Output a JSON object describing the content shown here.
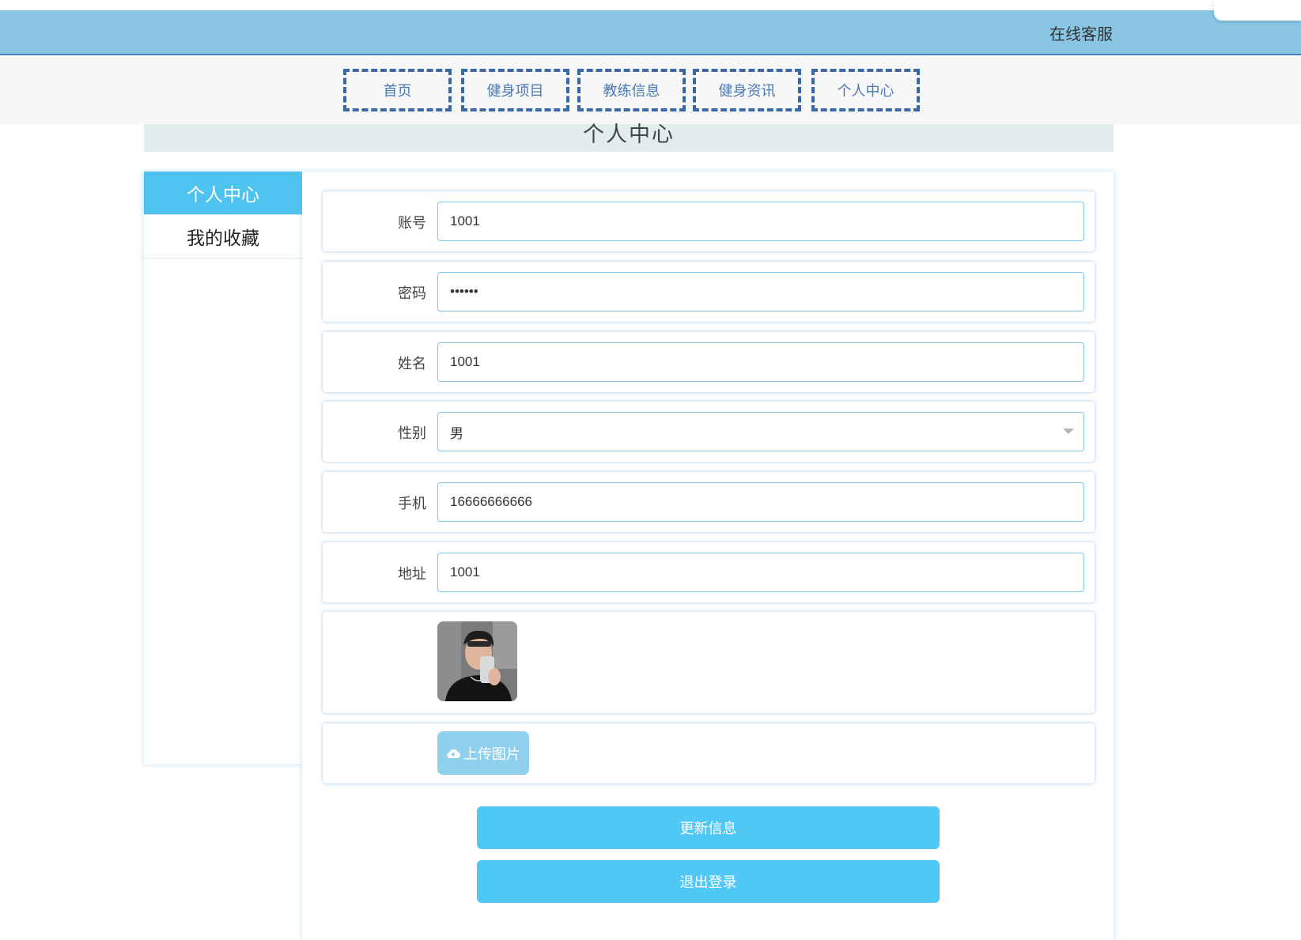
{
  "header": {
    "service_label": "在线客服"
  },
  "nav": {
    "items": [
      {
        "label": "首页"
      },
      {
        "label": "健身项目"
      },
      {
        "label": "教练信息"
      },
      {
        "label": "健身资讯"
      },
      {
        "label": "个人中心"
      }
    ]
  },
  "page": {
    "title": "个人中心"
  },
  "sidebar": {
    "items": [
      {
        "label": "个人中心",
        "active": true
      },
      {
        "label": "我的收藏",
        "active": false
      }
    ]
  },
  "form": {
    "account": {
      "label": "账号",
      "value": "1001"
    },
    "password": {
      "label": "密码",
      "value": "••••••"
    },
    "name": {
      "label": "姓名",
      "value": "1001"
    },
    "gender": {
      "label": "性别",
      "value": "男"
    },
    "phone": {
      "label": "手机",
      "value": "16666666666"
    },
    "address": {
      "label": "地址",
      "value": "1001"
    },
    "avatar": {
      "alt": "avatar-photo"
    },
    "upload": {
      "label": "上传图片",
      "icon": "cloud-upload-icon"
    }
  },
  "actions": {
    "update_label": "更新信息",
    "logout_label": "退出登录"
  },
  "colors": {
    "topbar": "#89c6e6",
    "nav_border": "#3a67a6",
    "accent": "#4fc8f5",
    "upload_button": "#8fd0ee",
    "title_bar": "#e0ecee"
  }
}
